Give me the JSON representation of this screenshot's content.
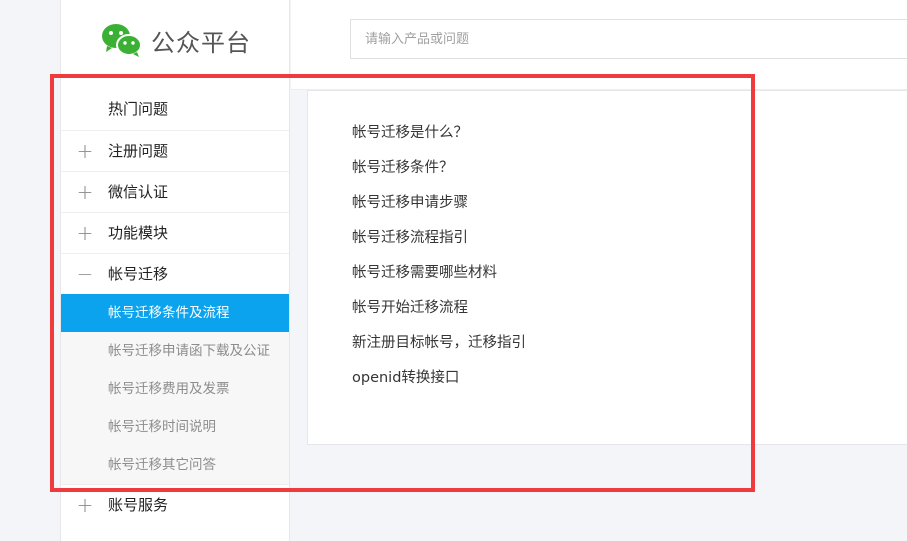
{
  "brand": {
    "name": "公众平台",
    "logo_icon": "wechat-logo-icon",
    "color": "#3cb034"
  },
  "search": {
    "placeholder": "请输入产品或问题",
    "value": ""
  },
  "sidebar": {
    "items": [
      {
        "label": "热门问题",
        "icon": "",
        "state": "none"
      },
      {
        "label": "注册问题",
        "icon": "+",
        "state": "collapsed"
      },
      {
        "label": "微信认证",
        "icon": "+",
        "state": "collapsed"
      },
      {
        "label": "功能模块",
        "icon": "+",
        "state": "collapsed"
      },
      {
        "label": "帐号迁移",
        "icon": "−",
        "state": "expanded"
      }
    ],
    "submenu": [
      {
        "label": "帐号迁移条件及流程",
        "active": true
      },
      {
        "label": "帐号迁移申请函下载及公证",
        "active": false
      },
      {
        "label": "帐号迁移费用及发票",
        "active": false
      },
      {
        "label": "帐号迁移时间说明",
        "active": false
      },
      {
        "label": "帐号迁移其它问答",
        "active": false
      }
    ],
    "after_items": [
      {
        "label": "账号服务",
        "icon": "+",
        "state": "collapsed"
      }
    ],
    "active_color": "#0ca3ee"
  },
  "main": {
    "links": [
      "帐号迁移是什么？",
      "帐号迁移条件？",
      "帐号迁移申请步骤",
      "帐号迁移流程指引",
      "帐号迁移需要哪些材料",
      "帐号开始迁移流程",
      "新注册目标帐号，迁移指引",
      "openid转换接口"
    ]
  },
  "annotation": {
    "color": "#ef3a3e"
  }
}
